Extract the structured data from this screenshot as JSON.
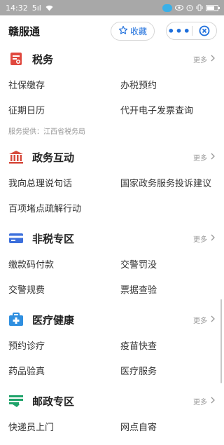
{
  "status_bar": {
    "time": "14:32",
    "signal": "5ıl",
    "battery_level": 0.7
  },
  "header": {
    "title": "赣服通",
    "favorite_label": "收藏",
    "more_label": "•••"
  },
  "sections": [
    {
      "title": "税务",
      "more": "更多",
      "icon": "tax-icon",
      "color": "#e0483e",
      "items": [
        "社保缴存",
        "办税预约",
        "征期日历",
        "代开电子发票查询"
      ],
      "provider": "服务提供：江西省税务局"
    },
    {
      "title": "政务互动",
      "more": "更多",
      "icon": "government-building-icon",
      "color": "#d64a3c",
      "items": [
        "我向总理说句话",
        "国家政务服务投诉建议",
        "百项堵点疏解行动"
      ]
    },
    {
      "title": "非税专区",
      "more": "更多",
      "icon": "card-icon",
      "color": "#3c6fdc",
      "items": [
        "缴款码付款",
        "交警罚没",
        "交警规费",
        "票据查验"
      ]
    },
    {
      "title": "医疗健康",
      "more": "更多",
      "icon": "medical-kit-icon",
      "color": "#2f8fe0",
      "items": [
        "预约诊疗",
        "疫苗快查",
        "药品验真",
        "医疗服务"
      ]
    },
    {
      "title": "邮政专区",
      "more": "更多",
      "icon": "china-post-icon",
      "color": "#1fa36a",
      "items": [
        "快递员上门",
        "网点自寄"
      ]
    }
  ]
}
